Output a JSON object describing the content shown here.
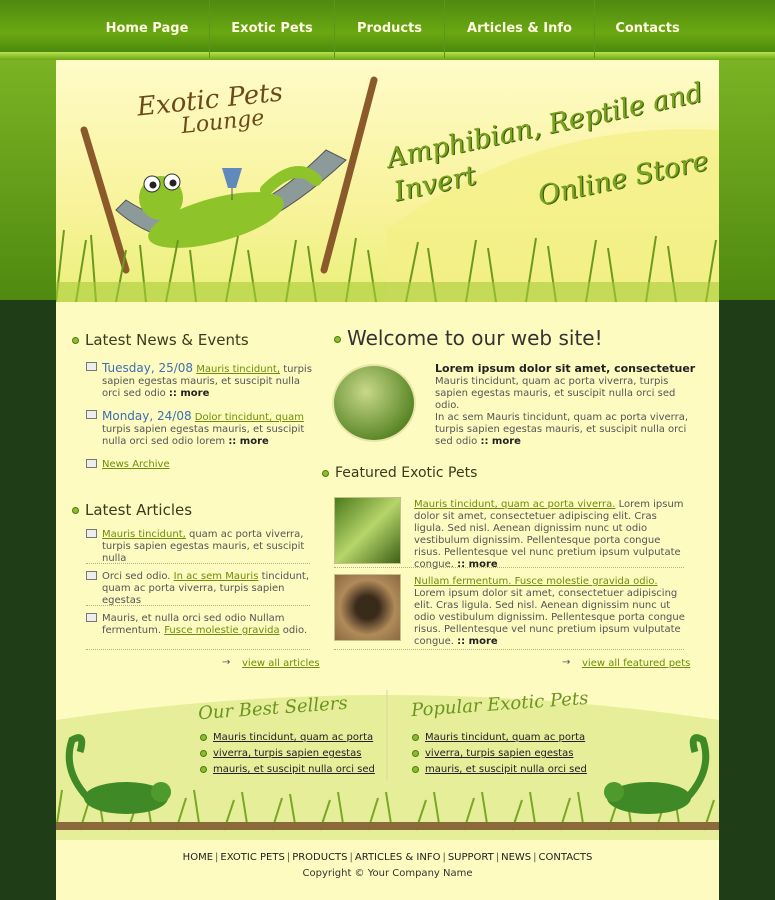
{
  "nav": {
    "items": [
      "Home Page",
      "Exotic Pets",
      "Products",
      "Articles & Info",
      "Contacts"
    ]
  },
  "header": {
    "logo_line1": "Exotic Pets",
    "logo_line2": "Lounge",
    "tagline_line1": "Amphibian, Reptile and Invert",
    "tagline_line2": "Online Store"
  },
  "news": {
    "title": "Latest News & Events",
    "items": [
      {
        "date": "Tuesday, 25/08",
        "link": "Mauris tincidunt,",
        "text": "turpis sapien egestas mauris, et suscipit nulla orci sed odio",
        "more": ":: more"
      },
      {
        "date": "Monday, 24/08",
        "link": "Dolor tincidunt, quam",
        "text": "turpis sapien egestas mauris, et suscipit nulla orci sed odio lorem",
        "more": ":: more"
      }
    ],
    "archive": "News Archive"
  },
  "articles": {
    "title": "Latest Articles",
    "items": [
      {
        "pre": "",
        "link": "Mauris tincidunt,",
        "post": " quam ac porta viverra, turpis sapien egestas mauris, et suscipit nulla"
      },
      {
        "pre": "Orci sed odio. ",
        "link": "In ac sem Mauris",
        "post": " tincidunt, quam ac porta viverra, turpis sapien egestas"
      },
      {
        "pre": "Mauris, et nulla orci sed odio Nullam fermentum. ",
        "link": "Fusce molestie gravida",
        "post": " odio."
      }
    ],
    "view_all": "view all articles"
  },
  "welcome": {
    "title": "Welcome to our web site!",
    "heading": "Lorem ipsum dolor sit amet, consectetuer",
    "p1": "Mauris tincidunt, quam ac porta viverra, turpis sapien egestas mauris, et suscipit nulla orci sed odio.",
    "p2": "In ac sem Mauris tincidunt, quam ac porta viverra, turpis sapien egestas mauris, et suscipit nulla orci sed odio",
    "more": ":: more"
  },
  "featured": {
    "title": "Featured Exotic Pets",
    "items": [
      {
        "link": "Mauris tincidunt, quam ac porta viverra.",
        "text": " Lorem ipsum dolor sit amet, consectetuer adipiscing elit. Cras ligula. Sed nisl. Aenean dignissim nunc ut odio vestibulum dignissim. Pellentesque porta congue risus. Pellentesque vel nunc pretium ipsum vulputate congue.",
        "more": ":: more"
      },
      {
        "link": "Nullam fermentum. Fusce molestie gravida odio.",
        "text": " Lorem ipsum dolor sit amet, consectetuer adipiscing elit. Cras ligula. Sed nisl. Aenean dignissim nunc ut odio vestibulum dignissim. Pellentesque porta congue risus. Pellentesque vel nunc pretium ipsum vulputate congue.",
        "more": ":: more"
      }
    ],
    "view_all": "view all featured pets"
  },
  "best_sellers": {
    "title": "Our Best Sellers",
    "items": [
      "Mauris tincidunt, quam ac porta",
      "viverra, turpis sapien egestas",
      "mauris, et suscipit nulla orci sed"
    ]
  },
  "popular": {
    "title": "Popular Exotic Pets",
    "items": [
      "Mauris tincidunt, quam ac porta",
      "viverra, turpis sapien egestas",
      "mauris, et suscipit nulla orci sed"
    ]
  },
  "footer": {
    "links": [
      "HOME",
      "EXOTIC PETS",
      "PRODUCTS",
      "ARTICLES & INFO",
      "SUPPORT",
      "NEWS",
      "CONTACTS"
    ],
    "copyright": "Copyright © Your Company Name"
  },
  "colors": {
    "accent": "#6d8e08",
    "nav_bg": "#5a9812",
    "page_bg": "#fdfbc0",
    "dark_bg": "#1f3d16"
  }
}
